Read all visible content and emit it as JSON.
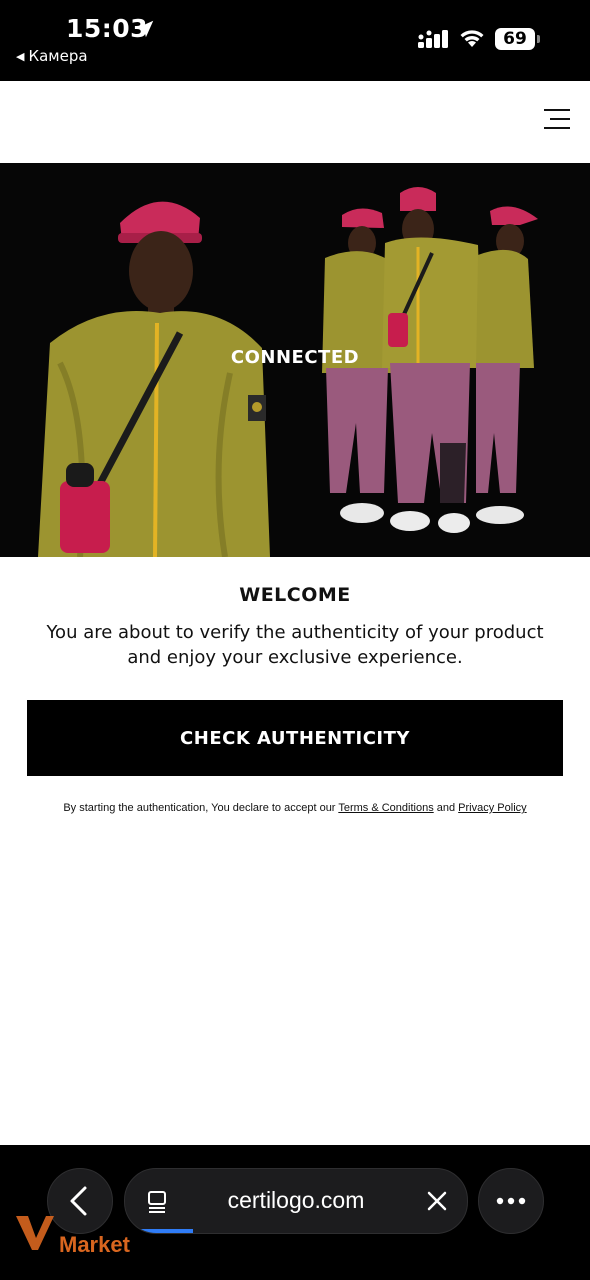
{
  "status_bar": {
    "time": "15:03",
    "back_app_label": "Камера",
    "battery_level": "69"
  },
  "header": {
    "menu_icon": "hamburger-menu-icon"
  },
  "hero": {
    "label": "CONNECTED"
  },
  "welcome": {
    "title": "WELCOME",
    "text": "You are about to verify the authenticity of your product and enjoy your exclusive experience.",
    "button_label": "CHECK AUTHENTICITY",
    "disclaimer_prefix": "By starting the authentication, You declare to accept our ",
    "terms_link": "Terms & Conditions",
    "disclaimer_and": " and ",
    "privacy_link": "Privacy Policy"
  },
  "browser": {
    "url": "certilogo.com",
    "load_progress": 0.2
  },
  "watermark": {
    "text": "Market"
  },
  "colors": {
    "brand_black": "#000000",
    "progress_blue": "#2f7cf6",
    "watermark_orange": "#d9661f"
  }
}
